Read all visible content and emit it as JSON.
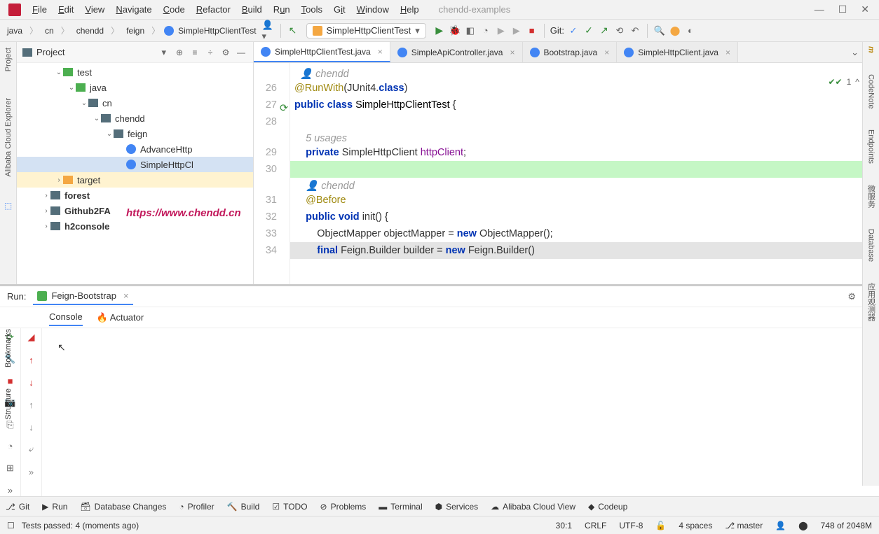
{
  "menubar": {
    "items": [
      "File",
      "Edit",
      "View",
      "Navigate",
      "Code",
      "Refactor",
      "Build",
      "Run",
      "Tools",
      "Git",
      "Window",
      "Help"
    ],
    "project_name": "chendd-examples"
  },
  "breadcrumb": {
    "parts": [
      "java",
      "cn",
      "chendd",
      "feign"
    ],
    "current": "SimpleHttpClientTest"
  },
  "run_config": {
    "selected": "SimpleHttpClientTest"
  },
  "git_label": "Git:",
  "project_panel": {
    "title": "Project",
    "tree": [
      {
        "label": "test",
        "depth": 3,
        "type": "folder-green",
        "expanded": true
      },
      {
        "label": "java",
        "depth": 4,
        "type": "folder-green",
        "expanded": true
      },
      {
        "label": "cn",
        "depth": 5,
        "type": "folder",
        "expanded": true
      },
      {
        "label": "chendd",
        "depth": 6,
        "type": "folder",
        "expanded": true
      },
      {
        "label": "feign",
        "depth": 7,
        "type": "folder",
        "expanded": true
      },
      {
        "label": "AdvanceHttp",
        "depth": 8,
        "type": "class"
      },
      {
        "label": "SimpleHttpCl",
        "depth": 8,
        "type": "class",
        "selected": true
      },
      {
        "label": "target",
        "depth": 3,
        "type": "folder-orange",
        "expanded": false,
        "highlighted": true
      },
      {
        "label": "forest",
        "depth": 2,
        "type": "module",
        "expanded": false
      },
      {
        "label": "Github2FA",
        "depth": 2,
        "type": "module",
        "expanded": false
      },
      {
        "label": "h2console",
        "depth": 2,
        "type": "module",
        "expanded": false
      }
    ]
  },
  "tabs": [
    {
      "label": "SimpleHttpClientTest.java",
      "active": true
    },
    {
      "label": "SimpleApiController.java",
      "active": false
    },
    {
      "label": "Bootstrap.java",
      "active": false
    },
    {
      "label": "SimpleHttpClient.java",
      "active": false
    }
  ],
  "editor": {
    "author": "chendd",
    "usages_hint": "5 usages",
    "line_numbers": [
      "26",
      "27",
      "28",
      "29",
      "30",
      "31",
      "32",
      "33",
      "34"
    ],
    "inspection": {
      "count": "1"
    },
    "url": "https://www.chendd.cn"
  },
  "run_panel": {
    "label": "Run:",
    "config": "Feign-Bootstrap",
    "tabs": [
      "Console",
      "Actuator"
    ]
  },
  "left_rail": [
    "Project",
    "Alibaba Cloud Explorer",
    "Bookmarks",
    "Structure"
  ],
  "right_rail": [
    "Maven",
    "CodeNote",
    "Endpoints",
    "微服务",
    "Database",
    "应用观测器"
  ],
  "bottom_toolbar": [
    "Git",
    "Run",
    "Database Changes",
    "Profiler",
    "Build",
    "TODO",
    "Problems",
    "Terminal",
    "Services",
    "Alibaba Cloud View",
    "Codeup"
  ],
  "status": {
    "message": "Tests passed: 4 (moments ago)",
    "position": "30:1",
    "line_ending": "CRLF",
    "encoding": "UTF-8",
    "indent": "4 spaces",
    "branch": "master",
    "memory": "748 of 2048M"
  }
}
